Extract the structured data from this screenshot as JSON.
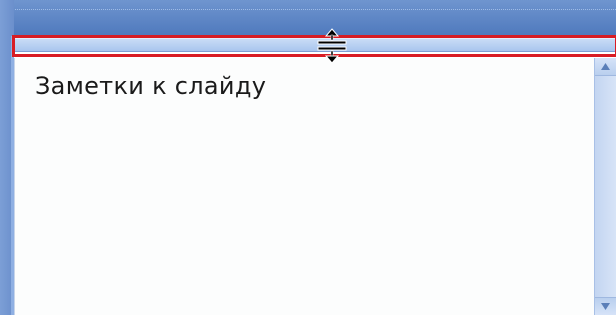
{
  "notes_pane": {
    "placeholder_text": "Заметки к слайду"
  },
  "icons": {
    "resize_cursor": "vertical-resize-cursor-icon",
    "scroll_up": "triangle-up-icon",
    "scroll_down": "triangle-down-icon"
  },
  "colors": {
    "highlight_border": "#d81c24",
    "window_blue": "#5a82c4",
    "splitter": "#b7cff1",
    "notes_background": "#fcfdfd",
    "scrollbar": "#c9d9f3"
  }
}
